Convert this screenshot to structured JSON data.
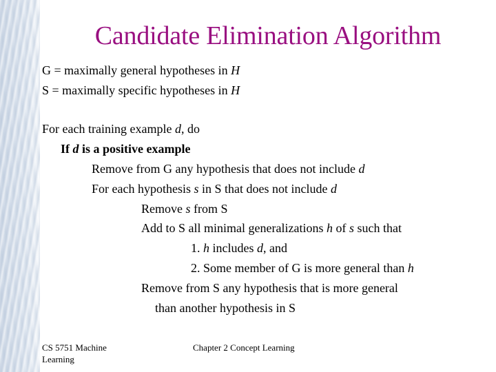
{
  "slide": {
    "title": "Candidate Elimination Algorithm",
    "title_color": "#990f80",
    "lines": [
      {
        "pre": "G = maximally general hypotheses in ",
        "var": "H",
        "post": ""
      },
      {
        "pre": "S = maximally specific hypotheses in ",
        "var": "H",
        "post": ""
      },
      {
        "pre": "For each training example ",
        "var": "d",
        "post": ", do"
      },
      {
        "pre": "If ",
        "var": "d",
        "post": " is a positive example"
      },
      {
        "pre": "Remove from G any hypothesis that does not include ",
        "var": "d",
        "post": ""
      },
      {
        "pre": "For each hypothesis ",
        "var": "s",
        "post": " in S that does not include ",
        "var2": "d"
      },
      {
        "pre": "Remove ",
        "var": "s",
        "post": " from S"
      },
      {
        "pre": "Add to S all minimal generalizations ",
        "var": "h",
        "post": " of ",
        "var2": "s",
        "post2": " such that"
      },
      {
        "pre": "1. ",
        "var": "h",
        "post": " includes ",
        "var2": "d",
        "post2": ", and"
      },
      {
        "pre": "2. Some member of G is more general than ",
        "var": "h",
        "post": ""
      },
      {
        "pre": "Remove from S any hypothesis that is more general",
        "var": "",
        "post": ""
      },
      {
        "pre": "than another hypothesis in S",
        "var": "",
        "post": ""
      }
    ]
  },
  "footer": {
    "course": "CS 5751 Machine Learning",
    "chapter": "Chapter 2  Concept Learning"
  }
}
